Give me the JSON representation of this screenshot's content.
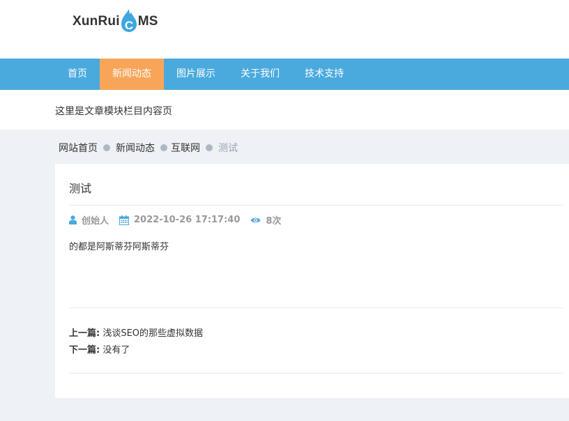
{
  "brand": {
    "logo_left": "XunRui",
    "logo_c": "C",
    "logo_right": "MS",
    "accent_color": "#4aa9dd"
  },
  "nav": {
    "items": [
      {
        "label": "首页"
      },
      {
        "label": "新闻动态",
        "active": true
      },
      {
        "label": "图片展示"
      },
      {
        "label": "关于我们"
      },
      {
        "label": "技术支持"
      }
    ],
    "active_color": "#f8a55a"
  },
  "page": {
    "subtitle": "这里是文章模块栏目内容页"
  },
  "breadcrumb": {
    "items": [
      "网站首页",
      "新闻动态",
      "互联网",
      "测试"
    ]
  },
  "article": {
    "title": "测试",
    "author": "创始人",
    "datetime": "2022-10-26 17:17:40",
    "views": "8次",
    "body": "的都是阿斯蒂芬阿斯蒂芬",
    "prev_label": "上一篇:",
    "prev_link": "浅谈SEO的那些虚拟数据",
    "next_label": "下一篇:",
    "next_link": "没有了",
    "icons": {
      "author": "user-icon",
      "date": "calendar-icon",
      "views": "eye-icon"
    }
  }
}
